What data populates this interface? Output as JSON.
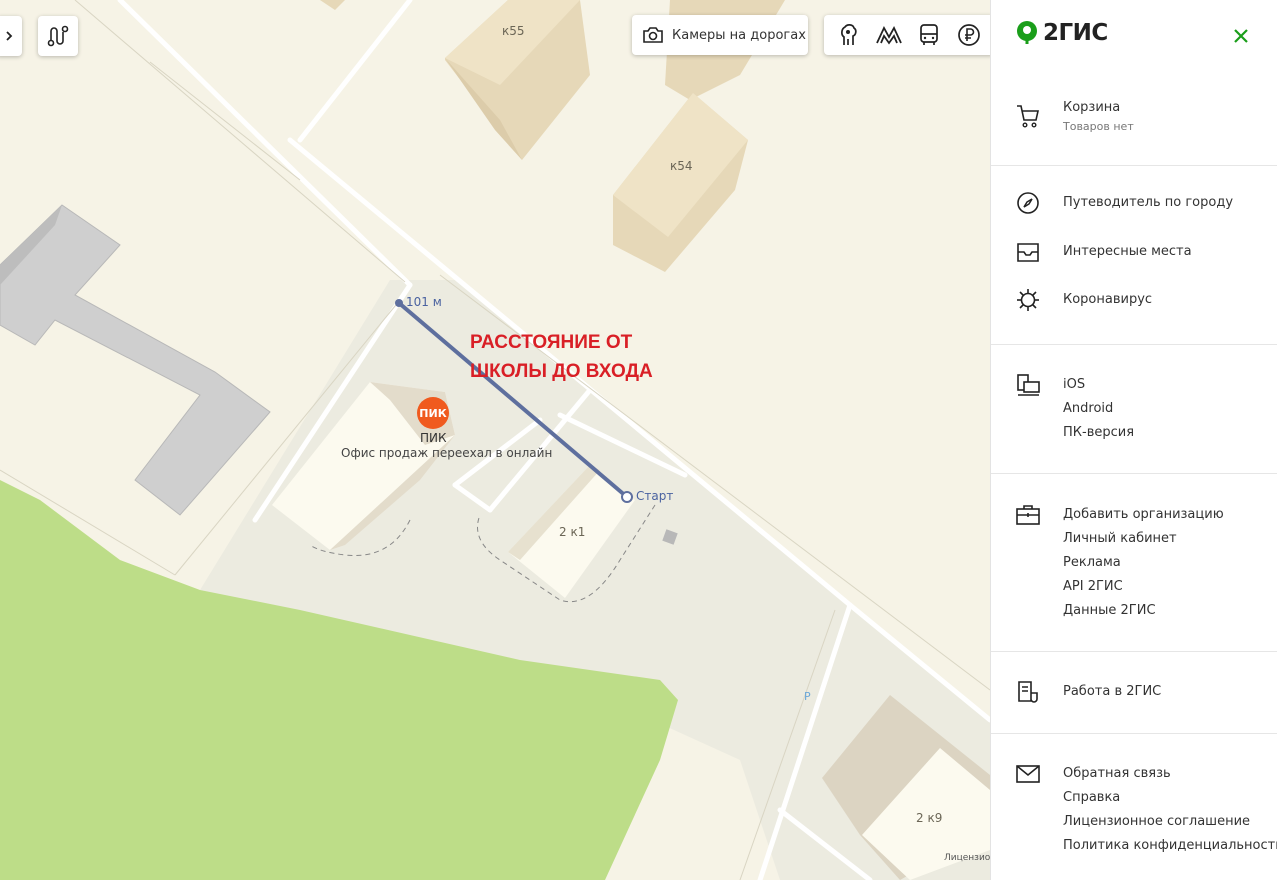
{
  "map": {
    "buildings": {
      "k55": "к55",
      "k54": "к54",
      "b2k1": "2 к1",
      "b2k9": "2 к9"
    },
    "poi": {
      "badge": "ПИК",
      "name": "ПИК",
      "description": "Офис продаж переехал в онлайн",
      "color": "#f05a1e"
    },
    "ruler": {
      "distance": "101 м",
      "start": "Старт"
    },
    "annotation": {
      "line1": "РАССТОЯНИЕ ОТ",
      "line2": "ШКОЛЫ ДО ВХОДА"
    },
    "toolbar": {
      "expand_icon": "chevron-right-icon",
      "route_icon": "route-icon",
      "cameras_label": "Камеры на дорогах",
      "cameras_icon": "camera-icon",
      "layers": [
        "attractions-icon",
        "metro-icon",
        "bus-icon",
        "ruble-icon"
      ]
    },
    "license_text": "Лицензион",
    "stray_label": "Р"
  },
  "panel": {
    "logo": "2ГИС",
    "close_icon": "close-icon",
    "cart": {
      "label": "Корзина",
      "sub": "Товаров нет",
      "icon": "cart-icon"
    },
    "guide": {
      "label": "Путеводитель по городу",
      "icon": "compass-icon"
    },
    "places": {
      "label": "Интересные места",
      "icon": "inbox-icon"
    },
    "covid": {
      "label": "Коронавирус",
      "icon": "virus-icon"
    },
    "apps": {
      "icon": "devices-icon",
      "items": [
        "iOS",
        "Android",
        "ПК-версия"
      ]
    },
    "business": {
      "icon": "briefcase-icon",
      "items": [
        "Добавить организацию",
        "Личный кабинет",
        "Реклама",
        "API 2ГИС",
        "Данные 2ГИС"
      ]
    },
    "jobs": {
      "label": "Работа в 2ГИС",
      "icon": "document-icon"
    },
    "contact": {
      "icon": "mail-icon",
      "items": [
        "Обратная связь",
        "Справка",
        "Лицензионное соглашение",
        "Политика конфиденциальности"
      ]
    },
    "accent": "#1a9e1a"
  }
}
